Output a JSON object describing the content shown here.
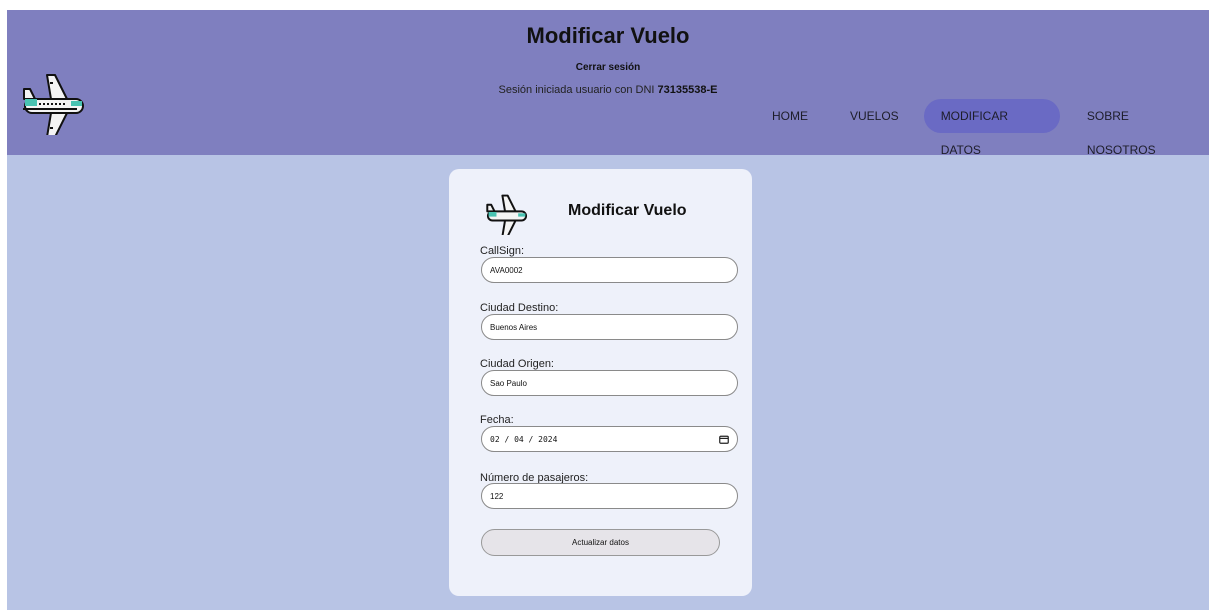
{
  "header": {
    "title": "Modificar Vuelo",
    "logout": "Cerrar sesión",
    "session_prefix": "Sesión iniciada usuario con DNI",
    "session_dni": "73135538-E"
  },
  "nav": {
    "items": [
      {
        "label": "HOME",
        "active": false
      },
      {
        "label": "VUELOS",
        "active": false
      },
      {
        "label": "MODIFICAR DATOS",
        "active": true
      },
      {
        "label": "SOBRE NOSOTROS",
        "active": false
      }
    ]
  },
  "form": {
    "title": "Modificar Vuelo",
    "fields": {
      "callsign": {
        "label": "CallSign:",
        "value": "AVA0002"
      },
      "destino": {
        "label": "Ciudad Destino:",
        "value": "Buenos Aires"
      },
      "origen": {
        "label": "Ciudad Origen:",
        "value": "Sao Paulo"
      },
      "fecha": {
        "label": "Fecha:",
        "value": "02 / 04 / 2024"
      },
      "pasajeros": {
        "label": "Número de pasajeros:",
        "value": "122"
      }
    },
    "submit_label": "Actualizar datos"
  },
  "icons": {
    "logo": "airplane-icon",
    "calendar": "calendar-icon"
  },
  "colors": {
    "header_bg": "#7f7fbf",
    "page_bg": "#b8c4e5",
    "nav_active": "#6a6ac4",
    "card_bg": "#eef1fa"
  }
}
